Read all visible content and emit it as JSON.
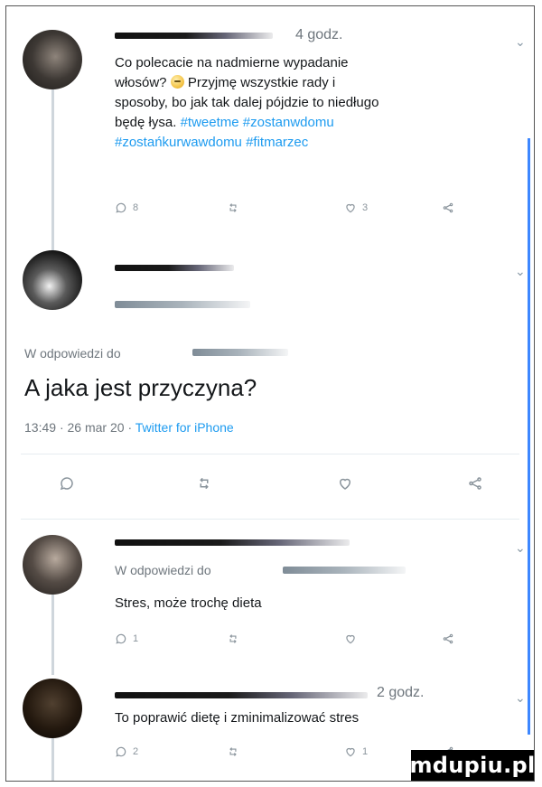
{
  "posts": [
    {
      "time": "4 godz.",
      "text_parts": [
        "Co polecacie na nadmierne wypadanie",
        "włosów?",
        "Przyjmę wszystkie rady i",
        "sposoby, bo jak tak dalej pójdzie to niedługo",
        "będę łysa."
      ],
      "hashtags": [
        "#tweetme",
        "#zostanwdomu",
        "#zostańkurwawdomu",
        "#fitmarzec"
      ],
      "counts": {
        "reply": "8",
        "retweet": "",
        "like": "3",
        "share": ""
      }
    },
    {
      "reply_label": "W odpowiedzi do",
      "text": "A jaka jest przyczyna?",
      "meta": {
        "time": "13:49",
        "date": "26 mar 20",
        "source": "Twitter for iPhone"
      }
    },
    {
      "reply_label": "W odpowiedzi do",
      "text": "Stres, może trochę dieta",
      "counts": {
        "reply": "1",
        "retweet": "",
        "like": "",
        "share": ""
      }
    },
    {
      "time": "2 godz.",
      "text": "To poprawić dietę i zminimalizować stres",
      "counts": {
        "reply": "2",
        "retweet": "",
        "like": "1",
        "share": ""
      }
    }
  ],
  "watermark": "mdupiu.pl",
  "colors": {
    "link": "#1d9bf0",
    "meta": "#6e767d",
    "rule": "#3d87ff"
  }
}
